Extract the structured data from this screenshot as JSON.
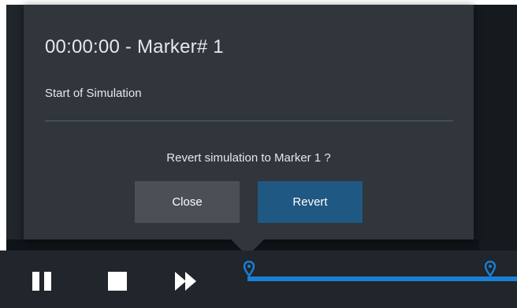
{
  "popup": {
    "title": "00:00:00 - Marker# 1",
    "description": "Start of Simulation",
    "question": "Revert simulation to Marker 1 ?",
    "close_label": "Close",
    "revert_label": "Revert"
  },
  "controls": {
    "pause_icon": "pause-icon",
    "stop_icon": "stop-icon",
    "fast_forward_icon": "fast-forward-icon"
  },
  "timeline": {
    "markers": [
      "marker-1",
      "marker-2"
    ],
    "accent_color": "#1a7fd4"
  },
  "colors": {
    "popup_bg": "#30363b",
    "revert_button": "#1f5882",
    "close_button": "#4a5055"
  }
}
